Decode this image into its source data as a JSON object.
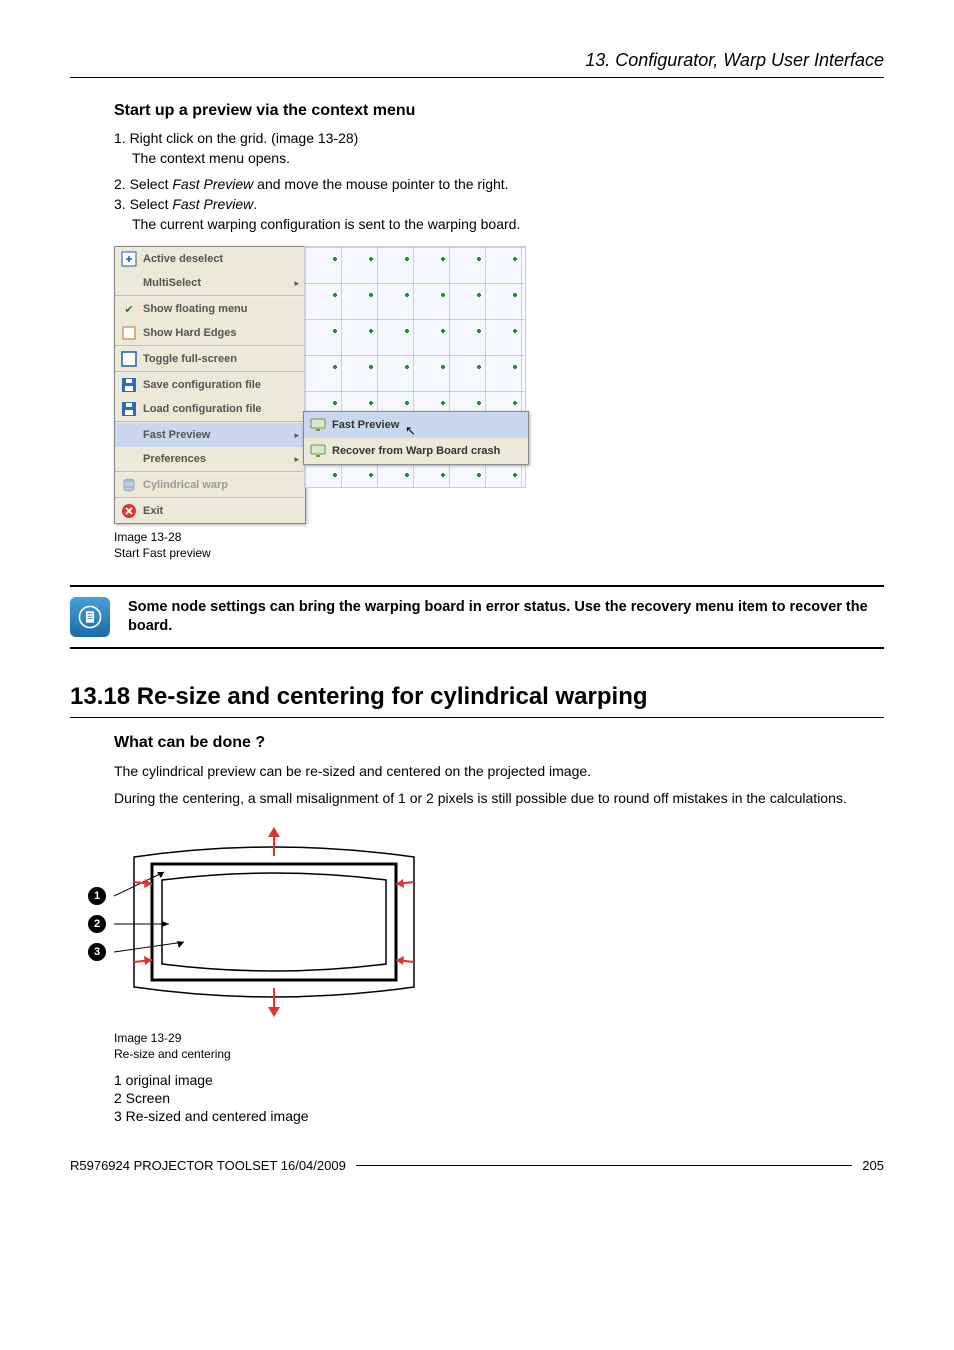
{
  "running_head": "13.  Configurator, Warp User Interface",
  "sec_a": {
    "heading": "Start up a preview via the context menu",
    "step1": "1. Right click on the grid.  (image 13-28)",
    "step1_sub": "The context menu opens.",
    "step2_pre": "2. Select ",
    "step2_em": "Fast Preview",
    "step2_post": " and move the mouse pointer to the right.",
    "step3_pre": "3. Select ",
    "step3_em": "Fast Preview",
    "step3_post": ".",
    "step3_sub": "The current warping configuration is sent to the warping board."
  },
  "context_menu": {
    "items": [
      "Active deselect",
      "MultiSelect",
      "Show floating menu",
      "Show Hard Edges",
      "Toggle full-screen",
      "Save configuration file",
      "Load configuration file",
      "Fast Preview",
      "Preferences",
      "Cylindrical warp",
      "Exit"
    ],
    "submenu": {
      "item1": "Fast Preview",
      "item2": "Recover from Warp Board crash"
    }
  },
  "fig1": {
    "num": "Image 13-28",
    "cap": "Start Fast preview"
  },
  "note": "Some node settings can bring the warping board in error status.  Use the recovery menu item to recover the board.",
  "sec_b": {
    "heading": "13.18 Re-size and centering for cylindrical warping",
    "sub": "What can be done ?",
    "p1": "The cylindrical preview can be re-sized and centered on the projected image.",
    "p2": "During the centering, a small misalignment of 1 or 2 pixels is still possible due to round off mistakes in the calculations."
  },
  "fig2": {
    "num": "Image 13-29",
    "cap": "Re-size and centering"
  },
  "legend": {
    "l1": "1   original image",
    "l2": "2   Screen",
    "l3": "3   Re-sized and centered image"
  },
  "footer": {
    "left": "R5976924   PROJECTOR TOOLSET  16/04/2009",
    "right": "205"
  }
}
